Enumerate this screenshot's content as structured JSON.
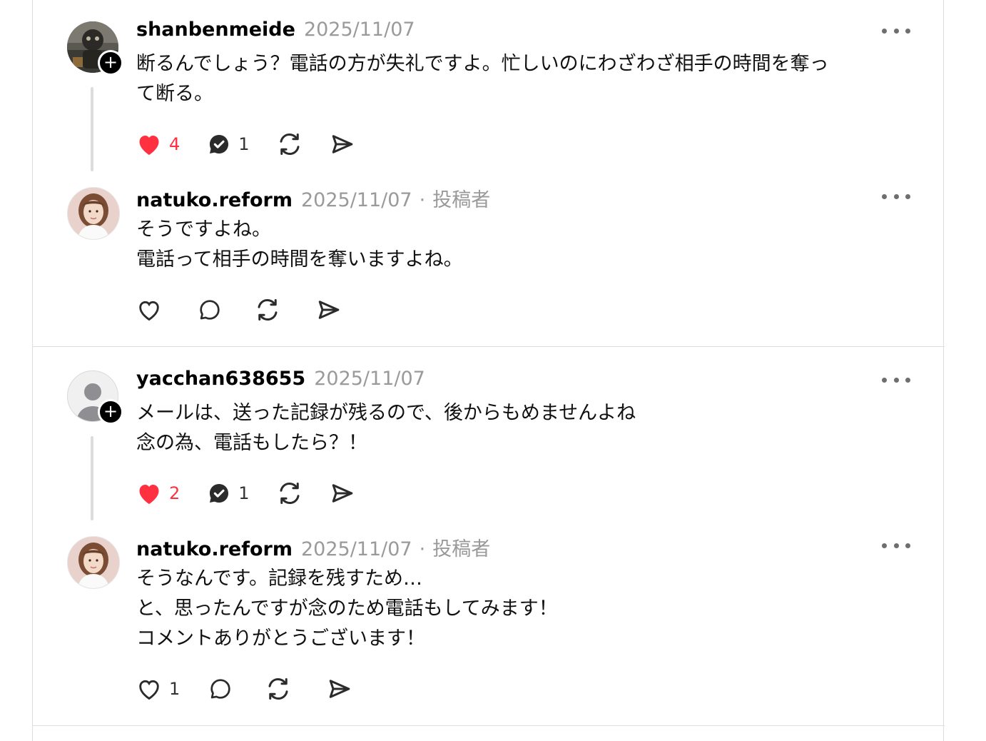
{
  "posts": [
    {
      "username": "shanbenmeide",
      "date": "2025/11/07",
      "author_badge": "",
      "text": "断るんでしょう？電話の方が失礼ですよ。忙しいのにわざわざ相手の時間を奪っ\nて断る。",
      "likes": "4",
      "replies": "1",
      "liked": true
    },
    {
      "username": "natuko.reform",
      "date": "2025/11/07",
      "author_badge": "投稿者",
      "text": "そうですよね。\n電話って相手の時間を奪いますよね。",
      "likes": "",
      "replies": "",
      "liked": false
    },
    {
      "username": "yacchan638655",
      "date": "2025/11/07",
      "author_badge": "",
      "text": "メールは、送った記録が残るので、後からもめませんよね\n念の為、電話もしたら？！",
      "likes": "2",
      "replies": "1",
      "liked": true
    },
    {
      "username": "natuko.reform",
      "date": "2025/11/07",
      "author_badge": "投稿者",
      "text": "そうなんです。記録を残すため…\nと、思ったんですが念のため電話もしてみます！\nコメントありがとうございます！",
      "likes": "1",
      "replies": "",
      "liked": false
    }
  ],
  "separator": "·",
  "colors": {
    "like_active": "#ff3040",
    "muted": "#9a9a9a",
    "divider": "#dedede"
  },
  "icons": [
    "heart-icon",
    "reply-icon",
    "repost-icon",
    "share-icon",
    "more-icon",
    "follow-plus-icon"
  ]
}
